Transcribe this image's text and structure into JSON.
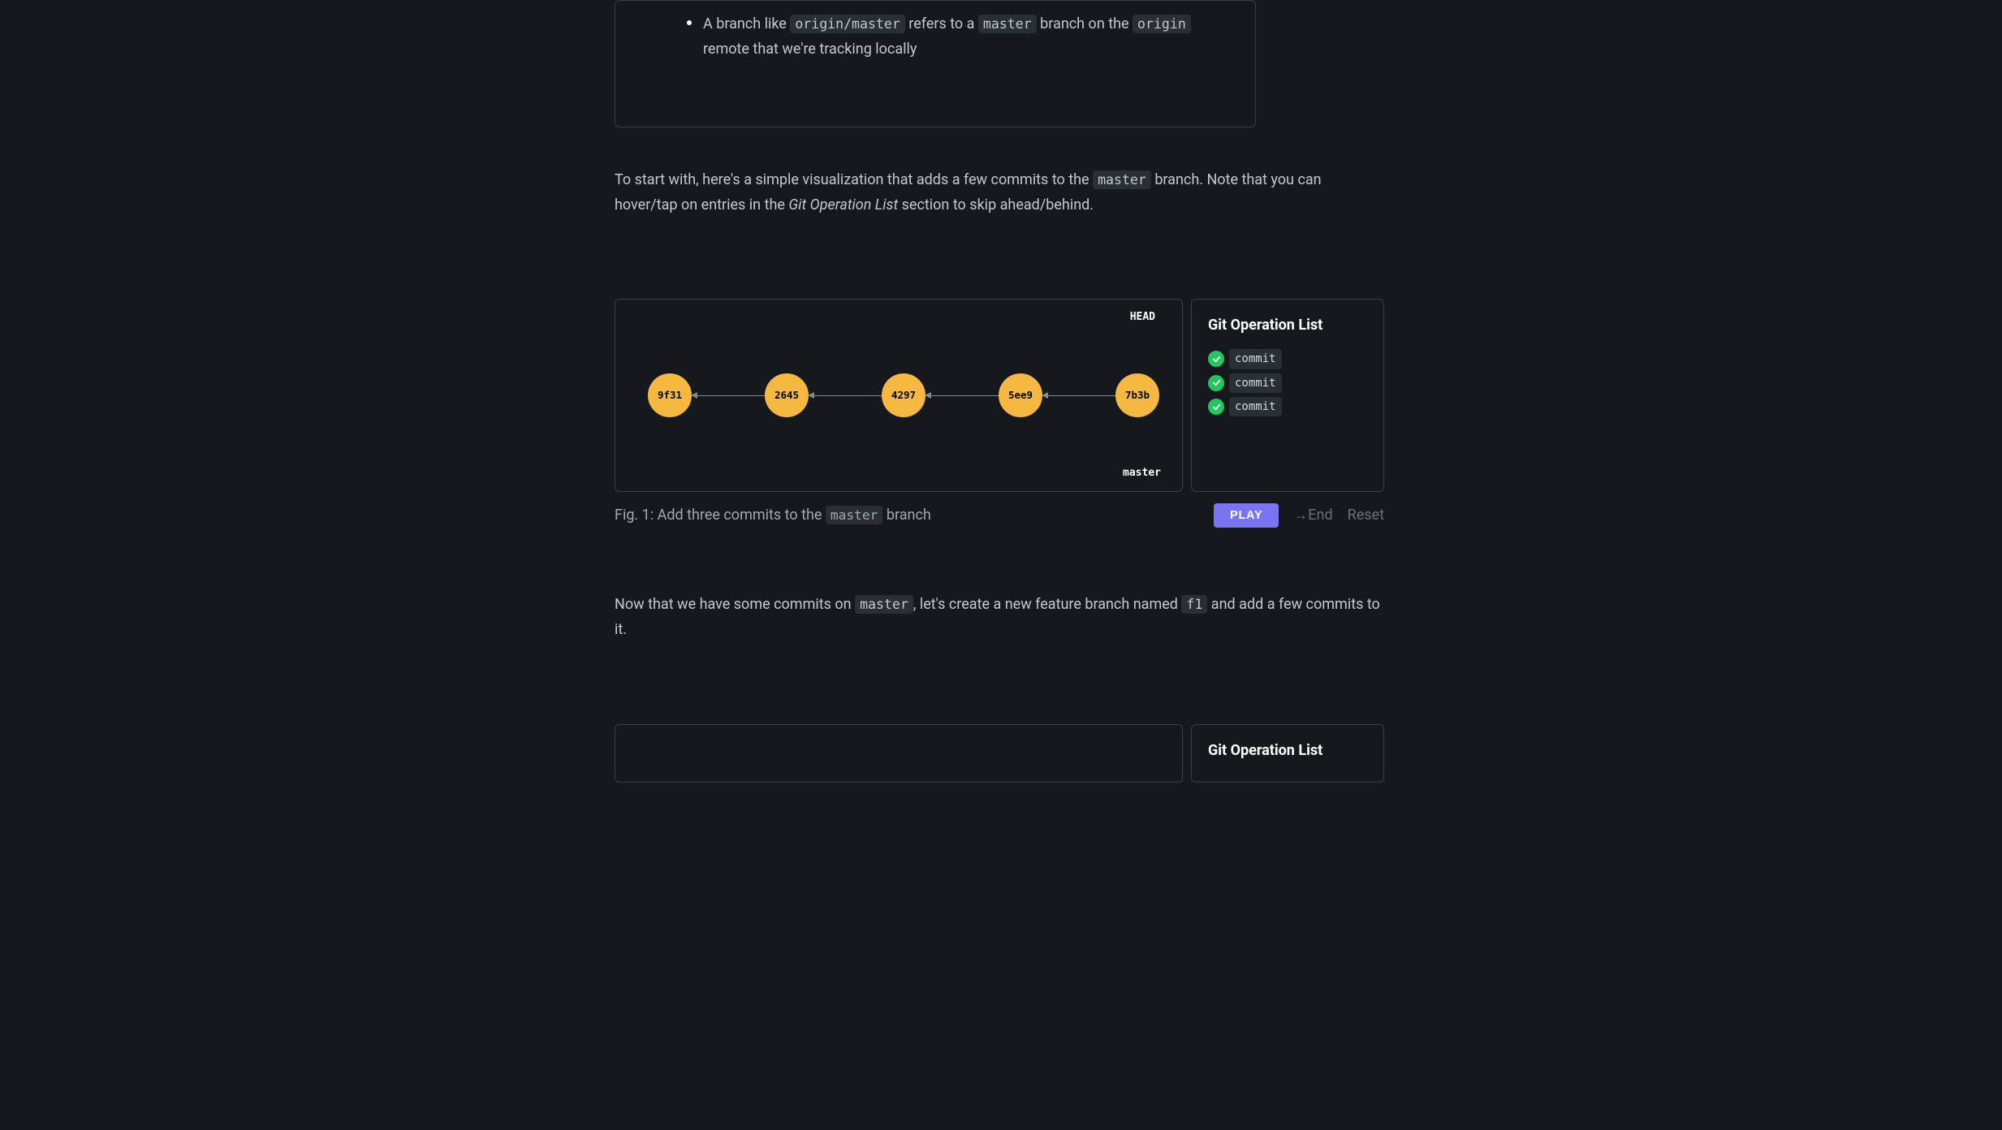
{
  "topBox": {
    "bullet_prefix": "A branch like ",
    "code1": "origin/master",
    "mid1": " refers to a ",
    "code2": "master",
    "mid2": " branch on the ",
    "code3": "origin",
    "mid3": " remote that we're tracking locally"
  },
  "para1": {
    "p1": "To start with, here's a simple visualization that adds a few commits to the ",
    "code1": "master",
    "p2": " branch. Note that you can hover/tap on entries in the ",
    "em1": "Git Operation List",
    "p3": " section to skip ahead/behind."
  },
  "viz1": {
    "commits": [
      "9f31",
      "2645",
      "4297",
      "5ee9",
      "7b3b"
    ],
    "head_label": "HEAD",
    "master_label": "master"
  },
  "ops1": {
    "title": "Git Operation List",
    "items": [
      "commit",
      "commit",
      "commit"
    ]
  },
  "fig1": {
    "prefix": "Fig. 1: Add three commits to the ",
    "code": "master",
    "suffix": " branch"
  },
  "controls": {
    "play": "PLAY",
    "end": "→End",
    "reset": "Reset"
  },
  "para2": {
    "p1": "Now that we have some commits on ",
    "code1": "master",
    "p2": ", let's create a new feature branch named ",
    "code2": "f1",
    "p3": " and add a few commits to it."
  },
  "ops2": {
    "title": "Git Operation List"
  }
}
